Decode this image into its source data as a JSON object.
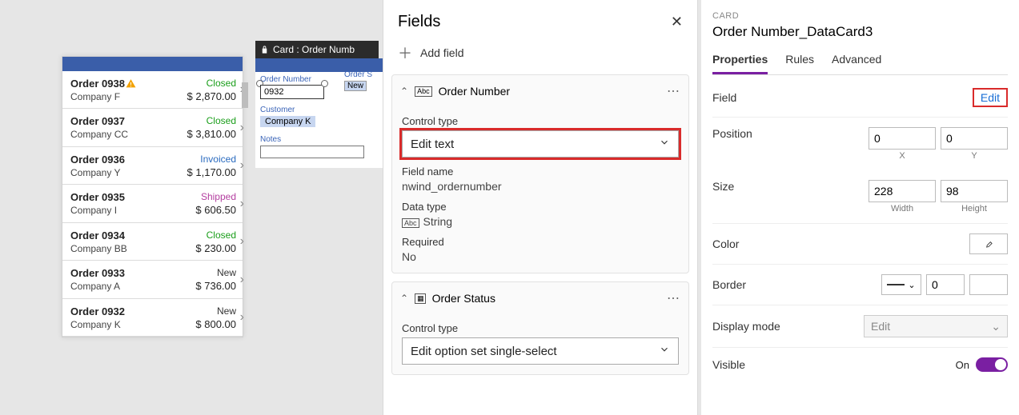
{
  "card_lock_label": "Card : Order Numb",
  "orders": [
    {
      "name": "Order 0938",
      "company": "Company F",
      "status": "Closed",
      "status_cls": "stat-closed",
      "price": "$ 2,870.00",
      "warn": true
    },
    {
      "name": "Order 0937",
      "company": "Company CC",
      "status": "Closed",
      "status_cls": "stat-closed",
      "price": "$ 3,810.00"
    },
    {
      "name": "Order 0936",
      "company": "Company Y",
      "status": "Invoiced",
      "status_cls": "stat-invoiced",
      "price": "$ 1,170.00"
    },
    {
      "name": "Order 0935",
      "company": "Company I",
      "status": "Shipped",
      "status_cls": "stat-shipped",
      "price": "$ 606.50"
    },
    {
      "name": "Order 0934",
      "company": "Company BB",
      "status": "Closed",
      "status_cls": "stat-closed",
      "price": "$ 230.00"
    },
    {
      "name": "Order 0933",
      "company": "Company A",
      "status": "New",
      "status_cls": "stat-new",
      "price": "$ 736.00"
    },
    {
      "name": "Order 0932",
      "company": "Company K",
      "status": "New",
      "status_cls": "stat-new",
      "price": "$ 800.00"
    }
  ],
  "mini": {
    "order_number_lbl": "Order Number",
    "order_number_val": "0932",
    "order_status_lbl": "Order S",
    "order_status_val": "New",
    "customer_lbl": "Customer",
    "customer_val": "Company K",
    "notes_lbl": "Notes"
  },
  "fields": {
    "title": "Fields",
    "add": "Add field",
    "order_number": {
      "heading": "Order Number",
      "control_type_lbl": "Control type",
      "control_type_val": "Edit text",
      "field_name_lbl": "Field name",
      "field_name_val": "nwind_ordernumber",
      "data_type_lbl": "Data type",
      "data_type_val": "String",
      "required_lbl": "Required",
      "required_val": "No"
    },
    "order_status": {
      "heading": "Order Status",
      "control_type_lbl": "Control type",
      "control_type_val": "Edit option set single-select"
    }
  },
  "props": {
    "card_label": "CARD",
    "title": "Order Number_DataCard3",
    "tabs": {
      "properties": "Properties",
      "rules": "Rules",
      "advanced": "Advanced"
    },
    "field_lbl": "Field",
    "edit": "Edit",
    "position_lbl": "Position",
    "pos_x": "0",
    "pos_y": "0",
    "x_lbl": "X",
    "y_lbl": "Y",
    "size_lbl": "Size",
    "w": "228",
    "h": "98",
    "w_lbl": "Width",
    "h_lbl": "Height",
    "color_lbl": "Color",
    "border_lbl": "Border",
    "border_val": "0",
    "display_mode_lbl": "Display mode",
    "display_mode_val": "Edit",
    "visible_lbl": "Visible",
    "visible_state": "On"
  }
}
